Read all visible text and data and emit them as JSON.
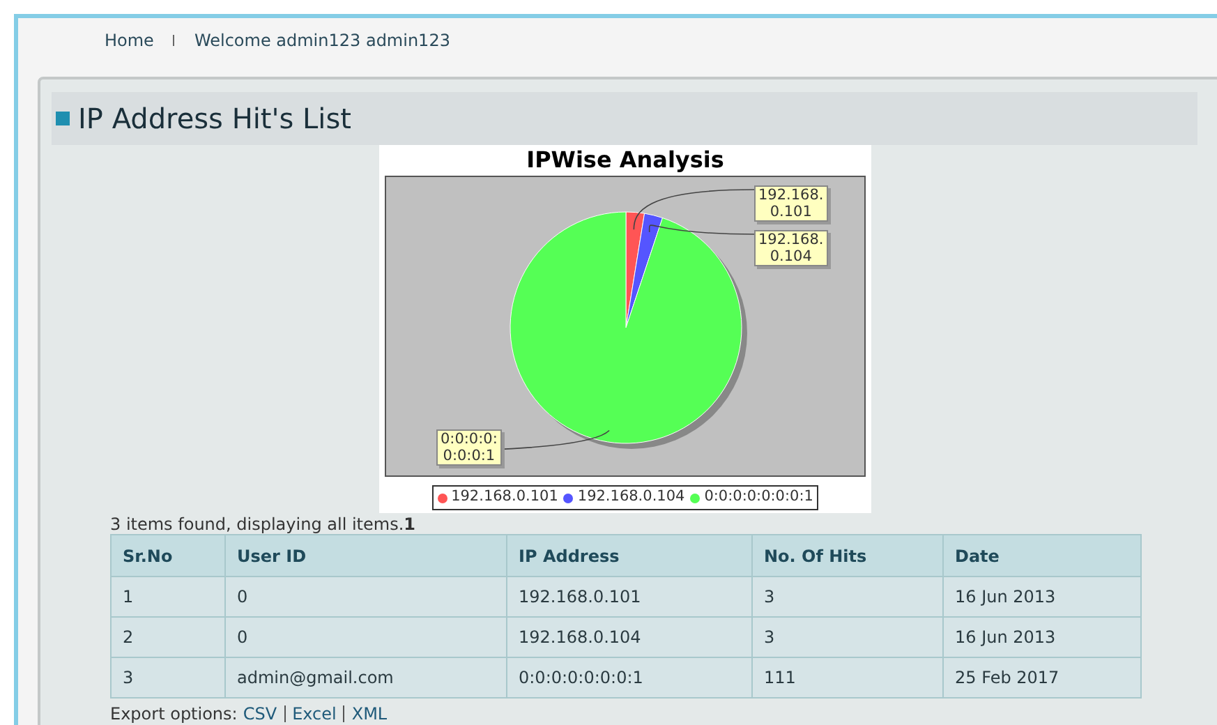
{
  "breadcrumb": [
    {
      "label": "Home"
    },
    {
      "label": "Welcome admin123 admin123"
    }
  ],
  "panel": {
    "title": "IP Address Hit's List"
  },
  "chart": {
    "chart_data": {
      "type": "pie",
      "title": "IPWise Analysis",
      "categories": [
        "192.168.0.101",
        "192.168.0.104",
        "0:0:0:0:0:0:0:1"
      ],
      "values": [
        2.56,
        2.56,
        94.88
      ],
      "legend": "bottom",
      "annotations": [
        {
          "text": "192.168.0.101"
        },
        {
          "text": "192.168.0.104"
        },
        {
          "text": "0:0:0:0:0:0:0:1"
        }
      ]
    },
    "slices": [
      {
        "color": "#ff5555"
      },
      {
        "color": "#5555ff"
      },
      {
        "color": "#55ff55"
      }
    ]
  },
  "summary": {
    "text": "3 items found, displaying all items.**1**"
  },
  "table": {
    "columns": [
      "Sr.No",
      "User ID",
      "IP Address",
      "No. Of Hits",
      "Date"
    ],
    "rows": [
      [
        "1",
        "0",
        "192.168.0.101",
        "3",
        "16 Jun 2013"
      ],
      [
        "2",
        "0",
        "192.168.0.104",
        "3",
        "16 Jun 2013"
      ],
      [
        "3",
        "admin@gmail.com",
        "0:0:0:0:0:0:0:1",
        "111",
        "25 Feb 2017"
      ]
    ]
  },
  "export": {
    "label": "Export options:",
    "links": [
      "CSV",
      "Excel",
      "XML"
    ]
  }
}
